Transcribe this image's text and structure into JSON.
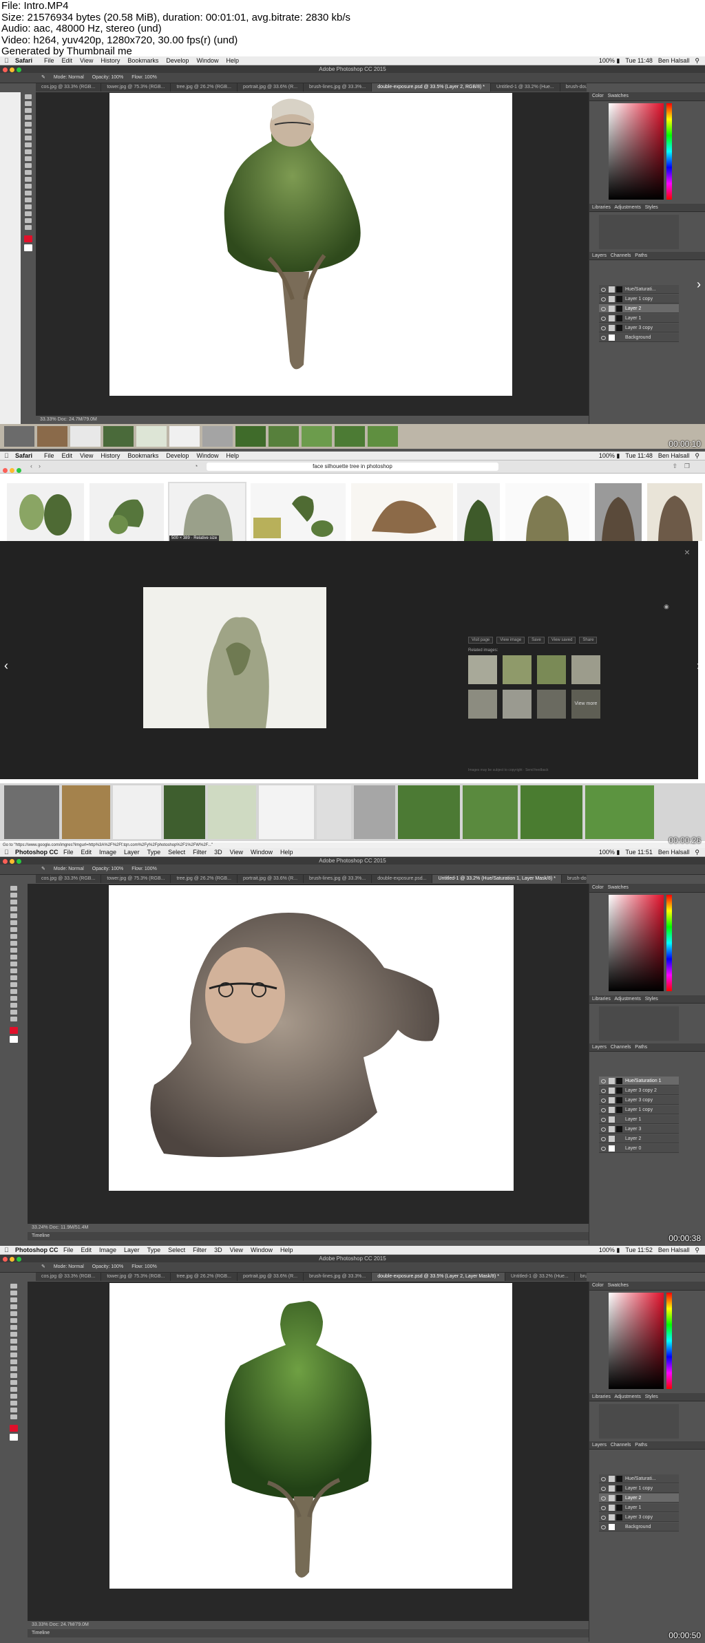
{
  "info": {
    "file": "File: Intro.MP4",
    "size": "Size: 21576934 bytes (20.58 MiB), duration: 00:01:01, avg.bitrate: 2830 kb/s",
    "audio": "Audio: aac, 48000 Hz, stereo (und)",
    "video": "Video: h264, yuv420p, 1280x720, 30.00 fps(r) (und)",
    "generator": "Generated by Thumbnail me"
  },
  "colors": {
    "red": "#fc5f57",
    "yellow": "#fdbc2e",
    "green": "#28c840",
    "accent": "#e0102a"
  },
  "frame1": {
    "app": "Safari",
    "menu": [
      "File",
      "Edit",
      "View",
      "History",
      "Bookmarks",
      "Develop",
      "Window",
      "Help"
    ],
    "clock": "Tue 11:48",
    "user": "Ben Halsall",
    "window_title": "Adobe Photoshop CC 2015",
    "options": [
      "Mode: Normal",
      "Opacity: 100%",
      "Flow: 100%"
    ],
    "tabs": [
      "cos.jpg @ 33.3% (RGB...",
      "tower.jpg @ 75.3% (RGB...",
      "tree.jpg @ 26.2% (RGB...",
      "portrait.jpg @ 33.6% (R...",
      "brush-lines.jpg @ 33.3%...",
      "double-exposure.psd @ 33.5% (Layer 2, RGB/8) *",
      "Untitled-1 @ 33.2% (Hue...",
      "brush-double-exposure.psd"
    ],
    "active_tab": 5,
    "status": "33.33%     Doc: 24.7M/79.0M",
    "timestamp": "00:00:10",
    "layers": [
      "Hue/Saturati...",
      "Layer 1 copy",
      "Layer 2",
      "Layer 1",
      "Layer 3 copy",
      "Background"
    ],
    "panels": [
      "Color",
      "Swatches",
      "Libraries",
      "Adjustments",
      "Styles",
      "Layers",
      "Channels",
      "Paths"
    ]
  },
  "frame2": {
    "app": "Safari",
    "menu": [
      "File",
      "Edit",
      "View",
      "History",
      "Bookmarks",
      "Develop",
      "Window",
      "Help"
    ],
    "clock": "Tue 11:48",
    "user": "Ben Halsall",
    "url": "face silhouette tree in photoshop",
    "thumb_tag": "500 × 389 · Relative size",
    "buttons": [
      "Visit page",
      "View image",
      "Save",
      "View saved",
      "Share"
    ],
    "related": "Related images:",
    "view_more": "View more",
    "footer": "Images may be subject to copyright · Send feedback",
    "statusbar": "Go to \"https://www.google.com/imgres?imgurl=http%3A%2F%2Ff.tqn.com%2Fy%2Fphotoshop%2F1%2FW%2F...\"",
    "timestamp": "00:00:26"
  },
  "frame3": {
    "app": "Photoshop CC",
    "menu": [
      "File",
      "Edit",
      "Image",
      "Layer",
      "Type",
      "Select",
      "Filter",
      "3D",
      "View",
      "Window",
      "Help"
    ],
    "clock": "Tue 11:51",
    "user": "Ben Halsall",
    "window_title": "Adobe Photoshop CC 2015",
    "options": [
      "Mode: Normal",
      "Opacity: 100%",
      "Flow: 100%"
    ],
    "tabs": [
      "cos.jpg @ 33.3% (RGB...",
      "tower.jpg @ 75.3% (RGB...",
      "tree.jpg @ 26.2% (RGB...",
      "portrait.jpg @ 33.6% (R...",
      "brush-lines.jpg @ 33.3%...",
      "double-exposure.psd...",
      "Untitled-1 @ 33.2% (Hue/Saturation 1, Layer Mask/8) *",
      "brush-double-exposure.psd"
    ],
    "active_tab": 6,
    "status": "33.24%     Doc: 11.9M/51.4M",
    "timeline": "Timeline",
    "timestamp": "00:00:38",
    "layers": [
      "Hue/Saturation 1",
      "Layer 3 copy 2",
      "Layer 3 copy",
      "Layer 1 copy",
      "Layer 1",
      "Layer 3",
      "Layer 2",
      "Layer 0"
    ],
    "panels": [
      "Color",
      "Swatches",
      "Libraries",
      "Adjustments",
      "Styles",
      "Layers",
      "Channels",
      "Paths"
    ]
  },
  "frame4": {
    "app": "Photoshop CC",
    "menu": [
      "File",
      "Edit",
      "Image",
      "Layer",
      "Type",
      "Select",
      "Filter",
      "3D",
      "View",
      "Window",
      "Help"
    ],
    "clock": "Tue 11:52",
    "user": "Ben Halsall",
    "window_title": "Adobe Photoshop CC 2015",
    "options": [
      "Mode: Normal",
      "Opacity: 100%",
      "Flow: 100%"
    ],
    "tabs": [
      "cos.jpg @ 33.3% (RGB...",
      "tower.jpg @ 75.3% (RGB...",
      "tree.jpg @ 26.2% (RGB...",
      "portrait.jpg @ 33.6% (R...",
      "brush-lines.jpg @ 33.3%...",
      "double-exposure.psd @ 33.5% (Layer 2, Layer Mask/8) *",
      "Untitled-1 @ 33.2% (Hue...",
      "brush-double-exposure.psd"
    ],
    "active_tab": 5,
    "status": "33.33%     Doc: 24.7M/79.0M",
    "timeline": "Timeline",
    "timestamp": "00:00:50",
    "layers": [
      "Hue/Saturati...",
      "Layer 1 copy",
      "Layer 2",
      "Layer 1",
      "Layer 3 copy",
      "Background"
    ],
    "panels": [
      "Color",
      "Swatches",
      "Libraries",
      "Adjustments",
      "Styles",
      "Layers",
      "Channels",
      "Paths"
    ]
  }
}
